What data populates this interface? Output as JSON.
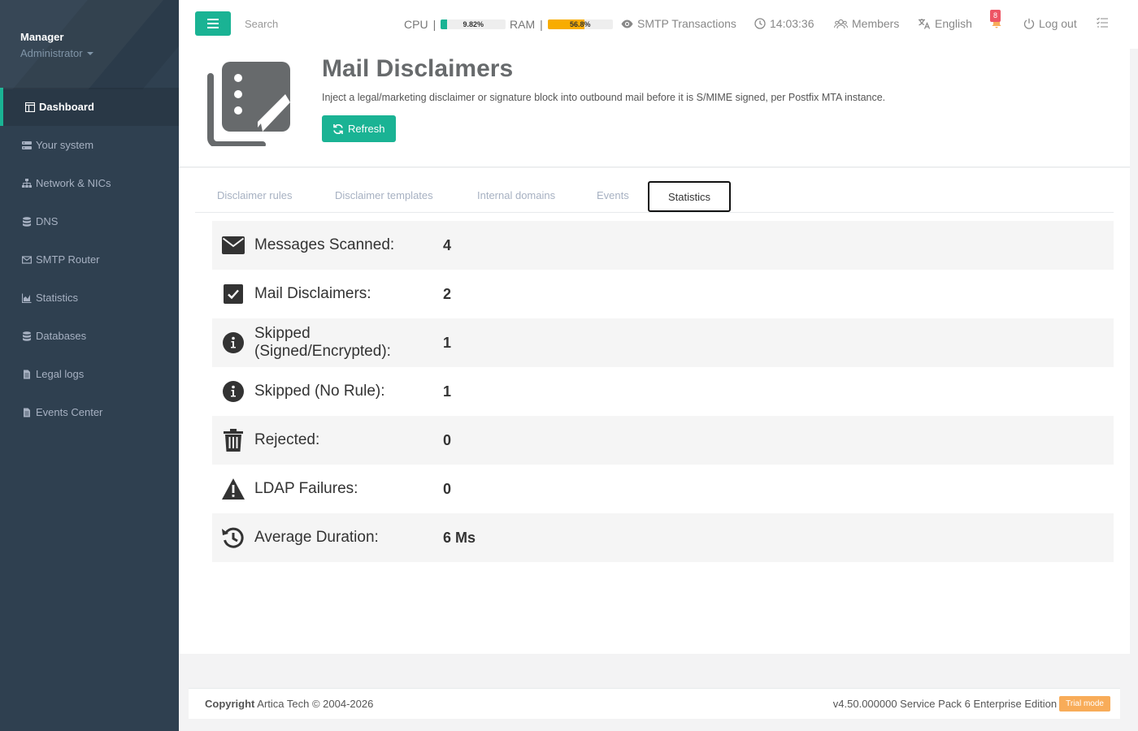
{
  "sidebar": {
    "user_name": "Manager",
    "user_role": "Administrator",
    "items": [
      {
        "label": "Dashboard",
        "icon": "dashboard-icon"
      },
      {
        "label": "Your system",
        "icon": "server-icon"
      },
      {
        "label": "Network & NICs",
        "icon": "network-icon"
      },
      {
        "label": "DNS",
        "icon": "database-icon"
      },
      {
        "label": "SMTP Router",
        "icon": "envelope-icon"
      },
      {
        "label": "Statistics",
        "icon": "chart-icon"
      },
      {
        "label": "Databases",
        "icon": "database-icon"
      },
      {
        "label": "Legal logs",
        "icon": "file-icon"
      },
      {
        "label": "Events Center",
        "icon": "file-icon"
      }
    ]
  },
  "topbar": {
    "search_placeholder": "Search",
    "cpu_label": "CPU",
    "cpu_value": "9.82%",
    "cpu_fraction": 0.0982,
    "ram_label": "RAM",
    "ram_value": "56.8%",
    "ram_fraction": 0.568,
    "smtp_transactions": "SMTP Transactions",
    "clock": "14:03:36",
    "members": "Members",
    "language": "English",
    "notifications_count": "8",
    "logout": "Log out"
  },
  "colors": {
    "accent": "#1ab394",
    "sidebar_bg": "#2f4050",
    "cpu_bar": "#1ab394",
    "ram_bar": "#f8ac00",
    "badge": "#ed5565",
    "trial": "#f8ac59"
  },
  "header": {
    "title": "Mail Disclaimers",
    "description": "Inject a legal/marketing disclaimer or signature block into outbound mail before it is S/MIME signed, per Postfix MTA instance.",
    "refresh_label": "Refresh"
  },
  "tabs": [
    {
      "label": "Disclaimer rules"
    },
    {
      "label": "Disclaimer templates"
    },
    {
      "label": "Internal domains"
    },
    {
      "label": "Events"
    },
    {
      "label": "Statistics"
    }
  ],
  "stats": [
    {
      "label": "Messages Scanned:",
      "value": "4",
      "icon": "envelope-icon"
    },
    {
      "label": "Mail Disclaimers:",
      "value": "2",
      "icon": "check-square-icon"
    },
    {
      "label": "Skipped (Signed/Encrypted):",
      "value": "1",
      "icon": "info-circle-icon"
    },
    {
      "label": "Skipped (No Rule):",
      "value": "1",
      "icon": "info-circle-icon"
    },
    {
      "label": "Rejected:",
      "value": "0",
      "icon": "trash-icon"
    },
    {
      "label": "LDAP Failures:",
      "value": "0",
      "icon": "warning-icon"
    },
    {
      "label": "Average Duration:",
      "value": "6 Ms",
      "icon": "history-icon"
    }
  ],
  "footer": {
    "copyright_label": "Copyright",
    "copyright_text": "Artica Tech © 2004-2026",
    "version": "v4.50.000000 Service Pack 6 Enterprise Edition",
    "trial": "Trial mode"
  }
}
